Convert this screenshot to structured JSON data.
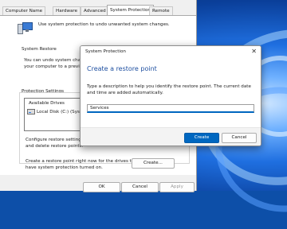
{
  "tabs": [
    {
      "label": "Computer Name"
    },
    {
      "label": "Hardware"
    },
    {
      "label": "Advanced"
    },
    {
      "label": "System Protection"
    },
    {
      "label": "Remote"
    }
  ],
  "intro_text": "Use system protection to undo unwanted system changes.",
  "system_restore": {
    "heading": "System Restore",
    "line1": "You can undo system chang",
    "line2": "your computer to a previou"
  },
  "protection_settings": {
    "heading": "Protection Settings",
    "list_header": "Available Drives",
    "drive_label": "Local Disk (C:) (System"
  },
  "configure": {
    "line1": "Configure restore settings, m",
    "line2": "and delete restore points."
  },
  "create_text": {
    "line1": "Create a restore point right now for the drives that",
    "line2": "have system protection turned on."
  },
  "create_button": "Create...",
  "ok_button": "OK",
  "cancel_button": "Cancel",
  "apply_button": "Apply",
  "dialog": {
    "title": "System Protection",
    "close_glyph": "✕",
    "heading": "Create a restore point",
    "description": "Type a description to help you identify the restore point. The current date and time are added automatically.",
    "input_value": "Services",
    "create_label": "Create",
    "cancel_label": "Cancel"
  },
  "colors": {
    "accent": "#0067c0",
    "heading_blue": "#1e4fa0"
  }
}
